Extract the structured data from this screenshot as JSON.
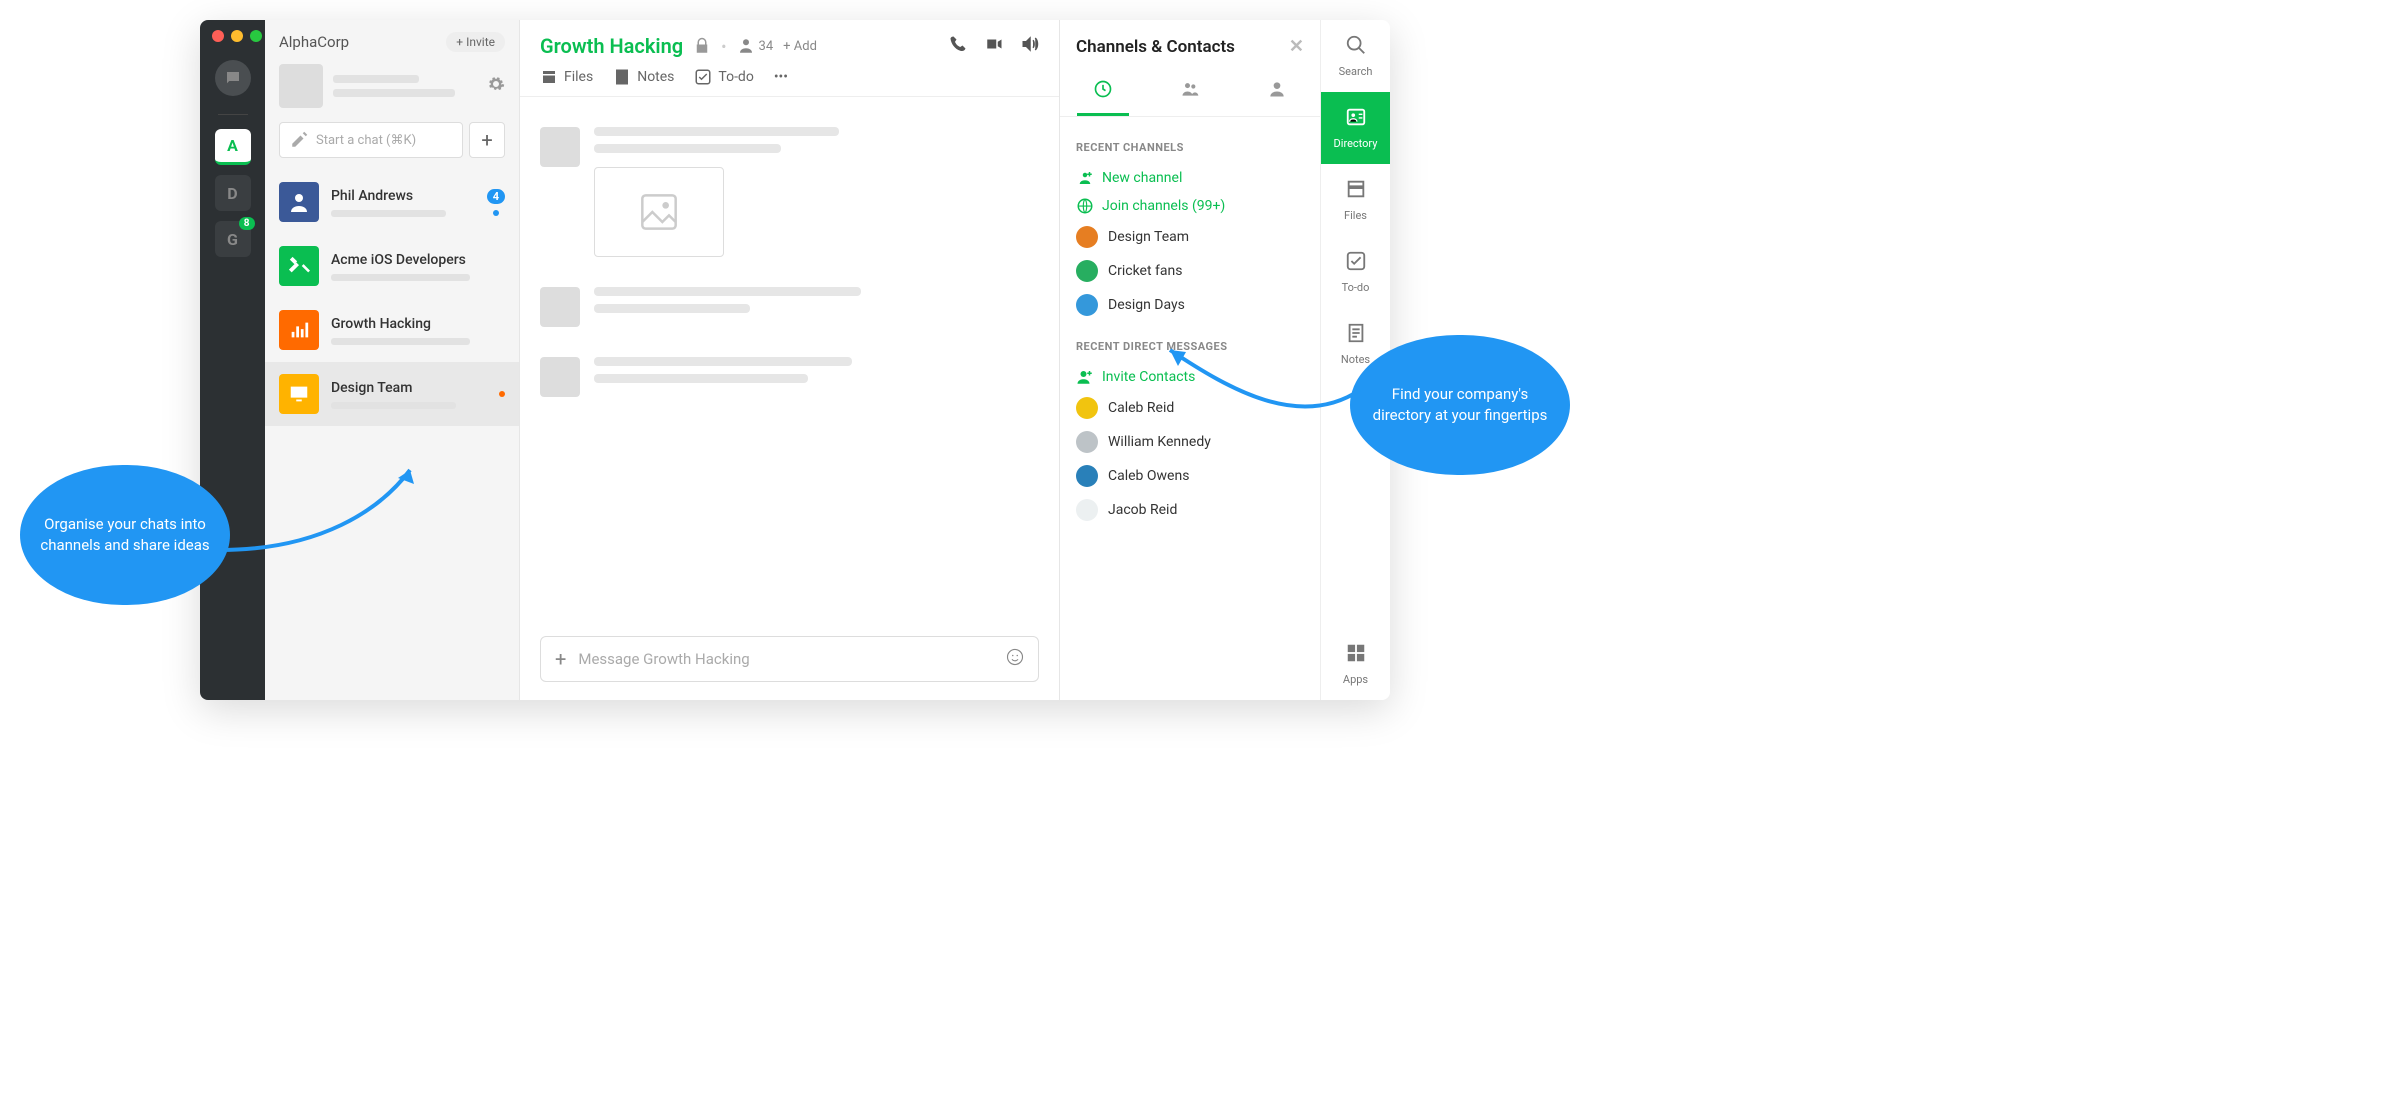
{
  "org": {
    "name": "AlphaCorp",
    "invite_label": "+ Invite"
  },
  "rail": {
    "workspaces": [
      {
        "label": "A",
        "active": true
      },
      {
        "label": "D",
        "active": false
      },
      {
        "label": "G",
        "active": false,
        "badge": "8"
      }
    ]
  },
  "sidebar": {
    "start_chat_placeholder": "Start a chat (⌘K)",
    "chats": [
      {
        "name": "Phil Andrews",
        "badge": "4",
        "avatar_color": "#3b5998",
        "dot_color": "#2196f3"
      },
      {
        "name": "Acme iOS Developers",
        "avatar_color": "#0abe51",
        "icon": "tools"
      },
      {
        "name": "Growth Hacking",
        "avatar_color": "#ff6a00",
        "icon": "chart"
      },
      {
        "name": "Design Team",
        "avatar_color": "#ffb300",
        "icon": "monitor",
        "dot_color": "#ff6a00",
        "selected": true
      }
    ]
  },
  "channel": {
    "title": "Growth Hacking",
    "member_count": "34",
    "add_label": "+ Add",
    "tabs": {
      "files": "Files",
      "notes": "Notes",
      "todo": "To-do"
    },
    "composer_placeholder": "Message Growth Hacking"
  },
  "panel": {
    "title": "Channels & Contacts",
    "sections": {
      "recent_channels_label": "RECENT CHANNELS",
      "new_channel": "New channel",
      "join_channels": "Join channels (99+)",
      "channels": [
        {
          "name": "Design Team",
          "color": "#e67e22"
        },
        {
          "name": "Cricket fans",
          "color": "#27ae60"
        },
        {
          "name": "Design Days",
          "color": "#3498db"
        }
      ],
      "recent_dm_label": "RECENT DIRECT MESSAGES",
      "invite_contacts": "Invite Contacts",
      "contacts": [
        {
          "name": "Caleb Reid"
        },
        {
          "name": "William Kennedy"
        },
        {
          "name": "Caleb Owens"
        },
        {
          "name": "Jacob Reid"
        }
      ]
    }
  },
  "tool_rail": {
    "items": [
      {
        "label": "Search",
        "icon": "search"
      },
      {
        "label": "Directory",
        "icon": "directory",
        "active": true
      },
      {
        "label": "Files",
        "icon": "files"
      },
      {
        "label": "To-do",
        "icon": "todo"
      },
      {
        "label": "Notes",
        "icon": "notes"
      }
    ],
    "apps_label": "Apps"
  },
  "callouts": {
    "left": "Organise your chats into channels and share ideas",
    "right": "Find your company's directory at your fingertips"
  }
}
